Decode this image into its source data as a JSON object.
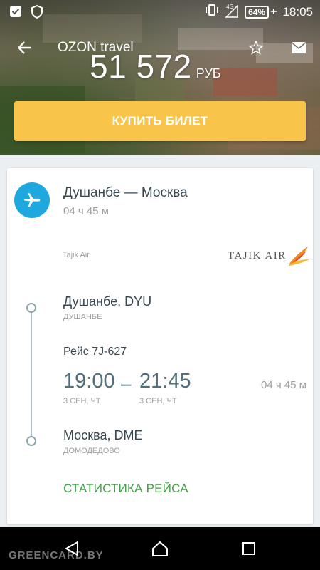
{
  "status_bar": {
    "time": "18:05",
    "battery": "64%",
    "network": "4G",
    "icons": [
      "check-icon",
      "shield-icon",
      "vibrate-icon",
      "signal-icon",
      "battery-icon"
    ]
  },
  "app_bar": {
    "title": "OZON travel",
    "icons": [
      "back-arrow-icon",
      "star-icon",
      "mail-icon"
    ]
  },
  "price": {
    "amount": "51 572",
    "currency": "РУБ"
  },
  "buy_button": {
    "label": "КУПИТЬ БИЛЕТ"
  },
  "flight": {
    "route": "Душанбе — Москва",
    "duration": "04 ч 45 м",
    "airline": "Tajik Air",
    "airline_logo_text": "TAJIK AIR",
    "departure": {
      "city": "Душанбе, DYU",
      "airport": "ДУШАНБЕ",
      "time": "19:00",
      "date": "3 СЕН, ЧТ"
    },
    "flight_number": "Рейс 7J-627",
    "time_separator": "–",
    "arrival": {
      "city": "Москва, DME",
      "airport": "ДОМОДЕДОВО",
      "time": "21:45",
      "date": "3 СЕН, ЧТ"
    },
    "segment_duration": "04 ч 45 м",
    "stats_link": "СТАТИСТИКА РЕЙСА"
  },
  "colors": {
    "accent_yellow": "#f8c44a",
    "plane_blue": "#1fa8de",
    "link_green": "#43a047"
  },
  "nav_bar": {
    "icons": [
      "nav-back-icon",
      "nav-home-icon",
      "nav-recent-icon"
    ],
    "watermark": "GREENCARD.BY"
  }
}
